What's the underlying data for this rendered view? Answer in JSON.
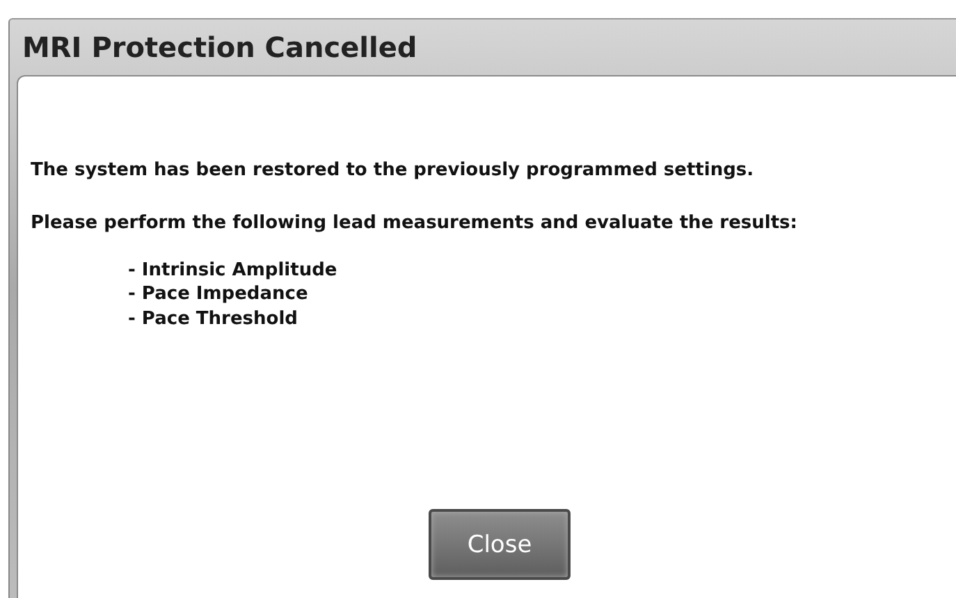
{
  "dialog": {
    "title": "MRI Protection Cancelled",
    "message": "The system has been restored to the previously programmed settings.",
    "instruction": "Please perform the following lead measurements and evaluate the results:",
    "measurements": [
      "- Intrinsic Amplitude",
      "- Pace Impedance",
      "- Pace Threshold"
    ],
    "buttons": [
      "Close"
    ]
  }
}
